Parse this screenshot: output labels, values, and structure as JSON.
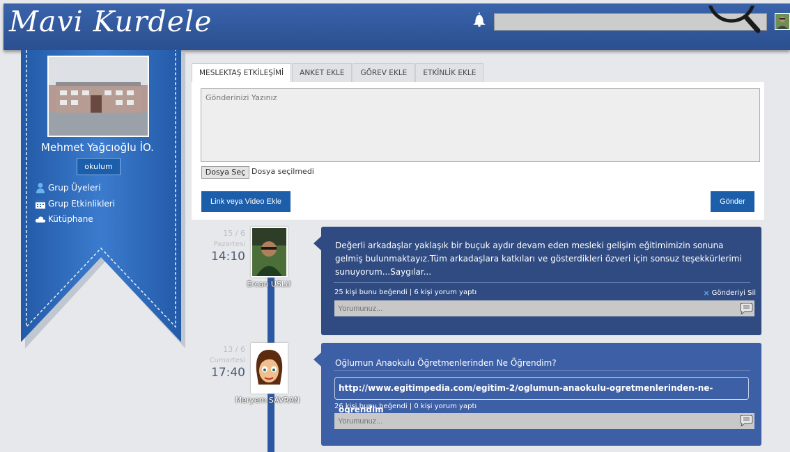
{
  "header": {
    "logo": "Mavi Kurdele",
    "search_placeholder": "",
    "icons": [
      "bell-icon",
      "search-icon",
      "user-avatar"
    ]
  },
  "sidebar": {
    "school_name": "Mehmet Yağcıoğlu İO.",
    "okulum_button": "okulum",
    "links": [
      {
        "label": "Grup Üyeleri",
        "icon": "user-icon"
      },
      {
        "label": "Grup Etkinlikleri",
        "icon": "calendar-icon"
      },
      {
        "label": "Kütüphane",
        "icon": "cloud-icon"
      }
    ]
  },
  "tabs": [
    "MESLEKTAŞ ETKİLEŞİMİ",
    "ANKET EKLE",
    "GÖREV EKLE",
    "ETKİNLİK EKLE"
  ],
  "composer": {
    "placeholder": "Gönderinizi Yazınız",
    "file_button": "Dosya Seç",
    "file_status": "Dosya seçilmedi",
    "link_button": "Link veya Video Ekle",
    "send_button": "Gönder"
  },
  "posts": [
    {
      "date": "15 / 6",
      "weekday": "Pazartesi",
      "time": "14:10",
      "author": "Ercan USLU",
      "text": "Değerli arkadaşlar yaklaşık bir buçuk aydır devam eden mesleki gelişim eğitimimizin sonuna gelmiş bulunmaktayız.Tüm arkadaşlara katkıları ve gösterdikleri özveri için sonsuz teşekkürlerimi sunuyorum...Saygılar...",
      "stats": "25 kişi bunu beğendi | 6 kişi yorum yaptı",
      "delete_label": "Gönderiyi Sil",
      "comment_placeholder": "Yorumunuz..."
    },
    {
      "date": "13 / 6",
      "weekday": "Cumartesi",
      "time": "17:40",
      "author": "Meryem SAVRAN",
      "text": "Oğlumun Anaokulu Öğretmenlerinden Ne Öğrendim?",
      "link": "http://www.egitimpedia.com/egitim-2/oglumun-anaokulu-ogretmenlerinden-ne-ogrendim",
      "stats": "26 kişi bunu beğendi | 0 kişi yorum yaptı",
      "comment_placeholder": "Yorumunuz..."
    }
  ],
  "colors": {
    "header": "#2f58a0",
    "ribbon": "#2a65b8",
    "post_dark": "#2f4b82",
    "post_light": "#3d5fa6",
    "button": "#1c5ea9"
  }
}
